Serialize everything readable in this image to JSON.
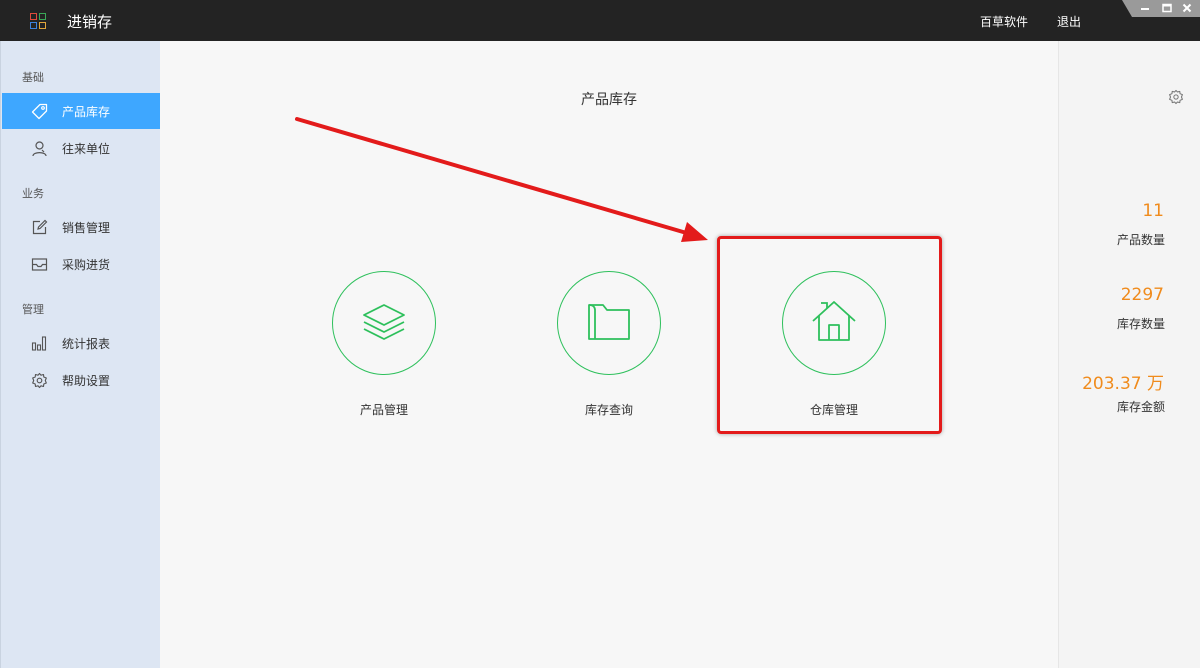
{
  "app": {
    "title": "进销存",
    "top_links": [
      "百草软件",
      "退出"
    ],
    "window_controls": [
      "minimize-icon",
      "maximize-icon",
      "close-icon"
    ]
  },
  "sidebar": {
    "sections": [
      {
        "label": "基础",
        "items": [
          {
            "label": "产品库存",
            "icon": "tag-icon",
            "active": true
          },
          {
            "label": "往来单位",
            "icon": "contacts-icon",
            "active": false
          }
        ]
      },
      {
        "label": "业务",
        "items": [
          {
            "label": "销售管理",
            "icon": "edit-icon",
            "active": false
          },
          {
            "label": "采购进货",
            "icon": "inbox-icon",
            "active": false
          }
        ]
      },
      {
        "label": "管理",
        "items": [
          {
            "label": "统计报表",
            "icon": "bar-chart-icon",
            "active": false
          },
          {
            "label": "帮助设置",
            "icon": "gear-icon",
            "active": false
          }
        ]
      }
    ]
  },
  "main": {
    "title": "产品库存",
    "tiles": [
      {
        "label": "产品管理",
        "icon": "layers-icon"
      },
      {
        "label": "库存查询",
        "icon": "folder-icon"
      },
      {
        "label": "仓库管理",
        "icon": "home-icon"
      }
    ]
  },
  "stats": [
    {
      "value": "11",
      "label": "产品数量"
    },
    {
      "value": "2297",
      "label": "库存数量"
    },
    {
      "value": "203.37 万",
      "label": "库存金额"
    }
  ],
  "colors": {
    "accent": "#3ea7ff",
    "tile_green": "#2ec05c",
    "stat_orange": "#f08b1c",
    "highlight_red": "#e31b1b",
    "titlebar": "#232323",
    "sidebar_bg": "#dde6f3"
  }
}
